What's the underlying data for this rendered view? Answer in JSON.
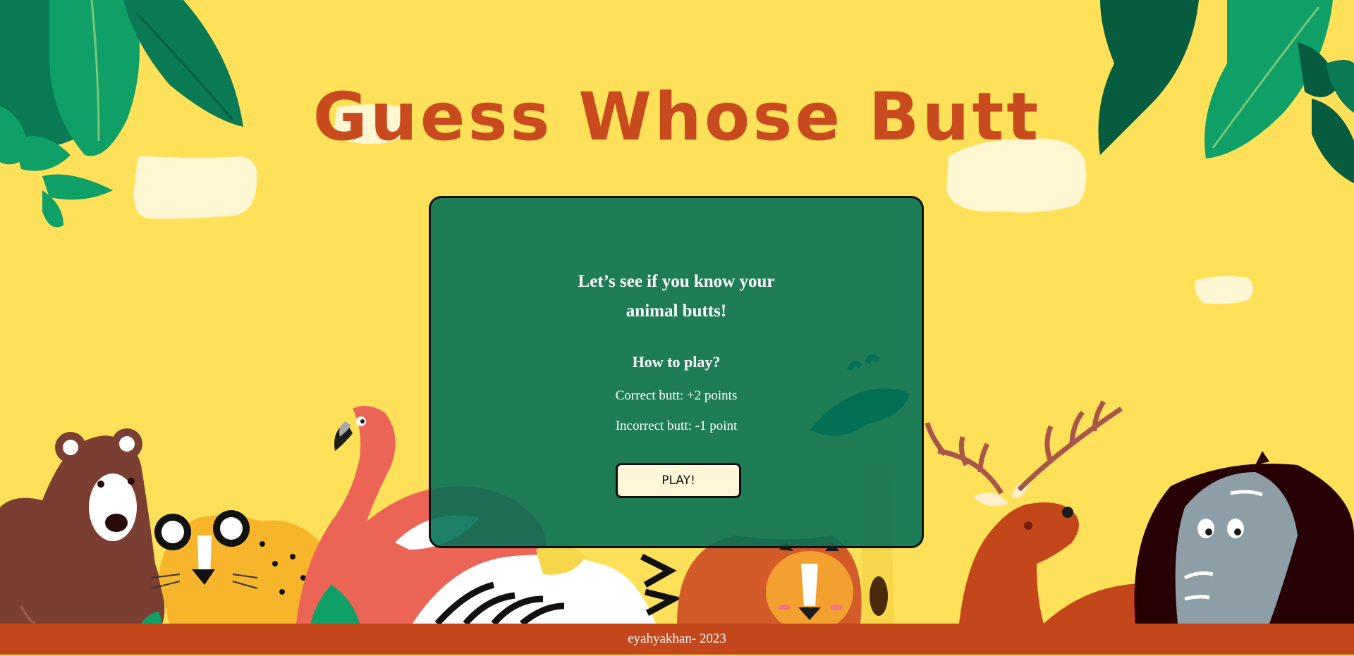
{
  "game": {
    "title": "Guess Whose Butt"
  },
  "card": {
    "intro_line1": "Let’s see if you know your",
    "intro_line2": "animal butts!",
    "how_to_title": "How to play?",
    "rule_correct": "Correct butt: +2 points",
    "rule_incorrect": "Incorrect butt: -1 point",
    "play_label": "PLAY!"
  },
  "footer": {
    "credit": "eyahyakhan- 2023"
  },
  "colors": {
    "background": "#FFE159",
    "title": "#C94A1E",
    "card": "#006E55",
    "button": "#FFF5D9",
    "footer": "#C4461B"
  },
  "illustration": {
    "animals": [
      "bear",
      "cheetah",
      "flamingo",
      "zebra",
      "lion",
      "giraffe",
      "deer",
      "elephant"
    ],
    "foliage": [
      "jungle-leaves-left",
      "jungle-leaves-right"
    ]
  }
}
